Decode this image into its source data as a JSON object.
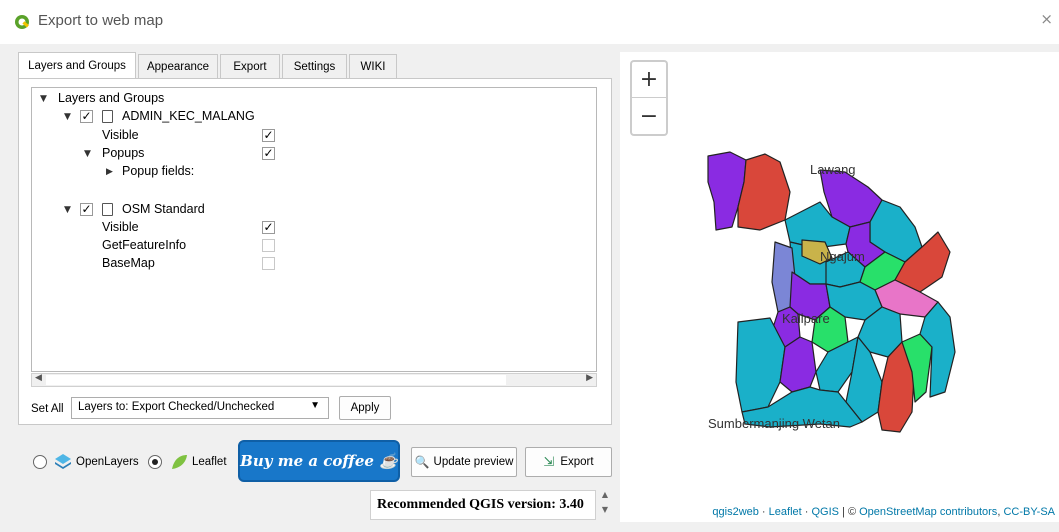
{
  "window": {
    "title": "Export to web map",
    "close_glyph": "×"
  },
  "tabs": [
    {
      "label": "Layers and Groups",
      "active": true
    },
    {
      "label": "Appearance"
    },
    {
      "label": "Export"
    },
    {
      "label": "Settings"
    },
    {
      "label": "WIKI"
    }
  ],
  "tree": {
    "root": "Layers and Groups",
    "layer1": {
      "name": "ADMIN_KEC_MALANG",
      "checked": true,
      "visible_label": "Visible",
      "popups_label": "Popups",
      "popup_fields_label": "Popup fields:"
    },
    "layer2": {
      "name": "OSM Standard",
      "checked": true,
      "visible_label": "Visible",
      "getfeatureinfo_label": "GetFeatureInfo",
      "basemap_label": "BaseMap"
    }
  },
  "setall": {
    "label": "Set All",
    "combo_value": "Layers to: Export Checked/Unchecked",
    "apply_label": "Apply"
  },
  "bottom": {
    "openlayers_label": "OpenLayers",
    "leaflet_label": "Leaflet",
    "selected": "Leaflet",
    "coffee_label": "Buy me a coffee ☕",
    "update_preview_label": "Update preview",
    "export_label": "Export",
    "version_text": "Recommended QGIS version: 3.40"
  },
  "map": {
    "zoom_in": "+",
    "zoom_out": "−",
    "labels": {
      "lawang": "Lawang",
      "ngajum": "Ngajum",
      "kalipare": "Kalipare",
      "sumbermanjing": "Sumbermanjing Wetan"
    },
    "attribution": {
      "qgis2web": "qgis2web",
      "sep1": " · ",
      "leaflet": "Leaflet",
      "sep2": " · ",
      "qgis": "QGIS",
      "sep3": " | © ",
      "osm": "OpenStreetMap contributors",
      "sep4": ", ",
      "license": "CC-BY-SA"
    },
    "colors": [
      "#8a2be2",
      "#d9473a",
      "#1ab0c9",
      "#28e06a",
      "#e875c8",
      "#7b86d6",
      "#c9b34a"
    ]
  }
}
